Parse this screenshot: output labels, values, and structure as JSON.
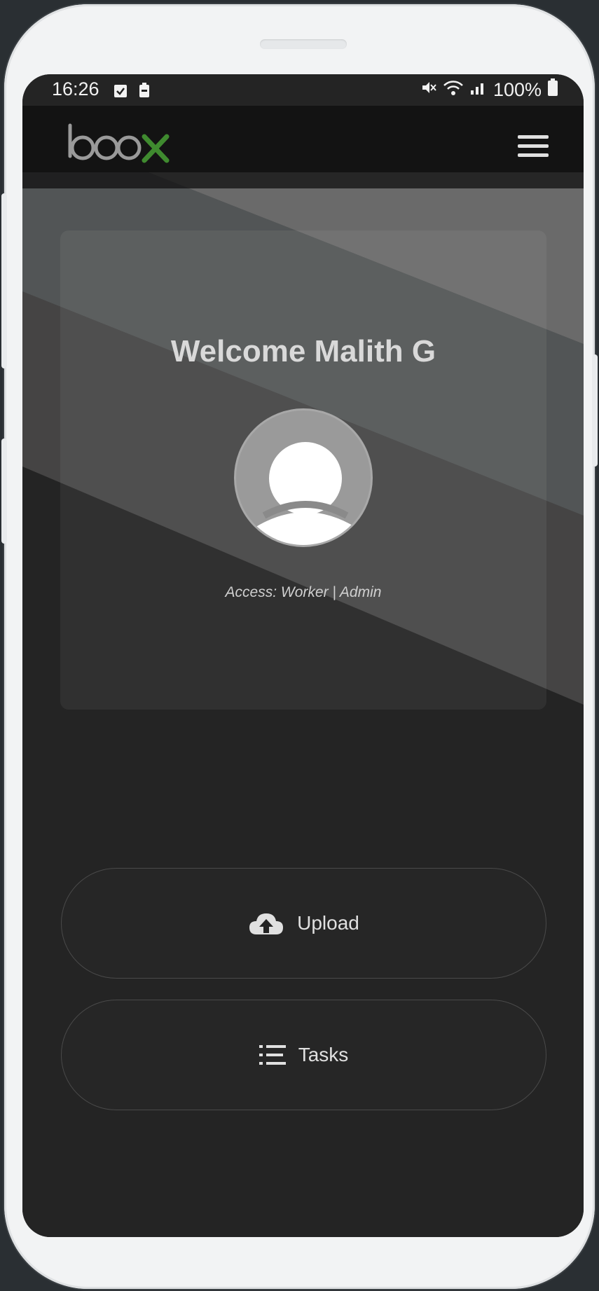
{
  "status_bar": {
    "time": "16:26",
    "battery_percent": "100%",
    "icons_left": [
      "checkbox-notification-icon",
      "battery-saver-icon"
    ],
    "icons_right": [
      "mute-icon",
      "wifi-icon",
      "signal-icon",
      "battery-icon"
    ]
  },
  "header": {
    "logo_text": "boox",
    "logo_accent_color": "#3f8a2f",
    "menu_icon": "hamburger-menu-icon"
  },
  "profile": {
    "welcome_text": "Welcome Malith G",
    "avatar_icon": "user-avatar-icon",
    "access_text": "Access: Worker | Admin"
  },
  "actions": {
    "upload": {
      "label": "Upload",
      "icon": "cloud-upload-icon"
    },
    "tasks": {
      "label": "Tasks",
      "icon": "task-list-icon"
    }
  },
  "colors": {
    "background": "#242424",
    "band_light": "#6b6b6b",
    "band_mid": "#525556",
    "band_dark": "#454444"
  }
}
